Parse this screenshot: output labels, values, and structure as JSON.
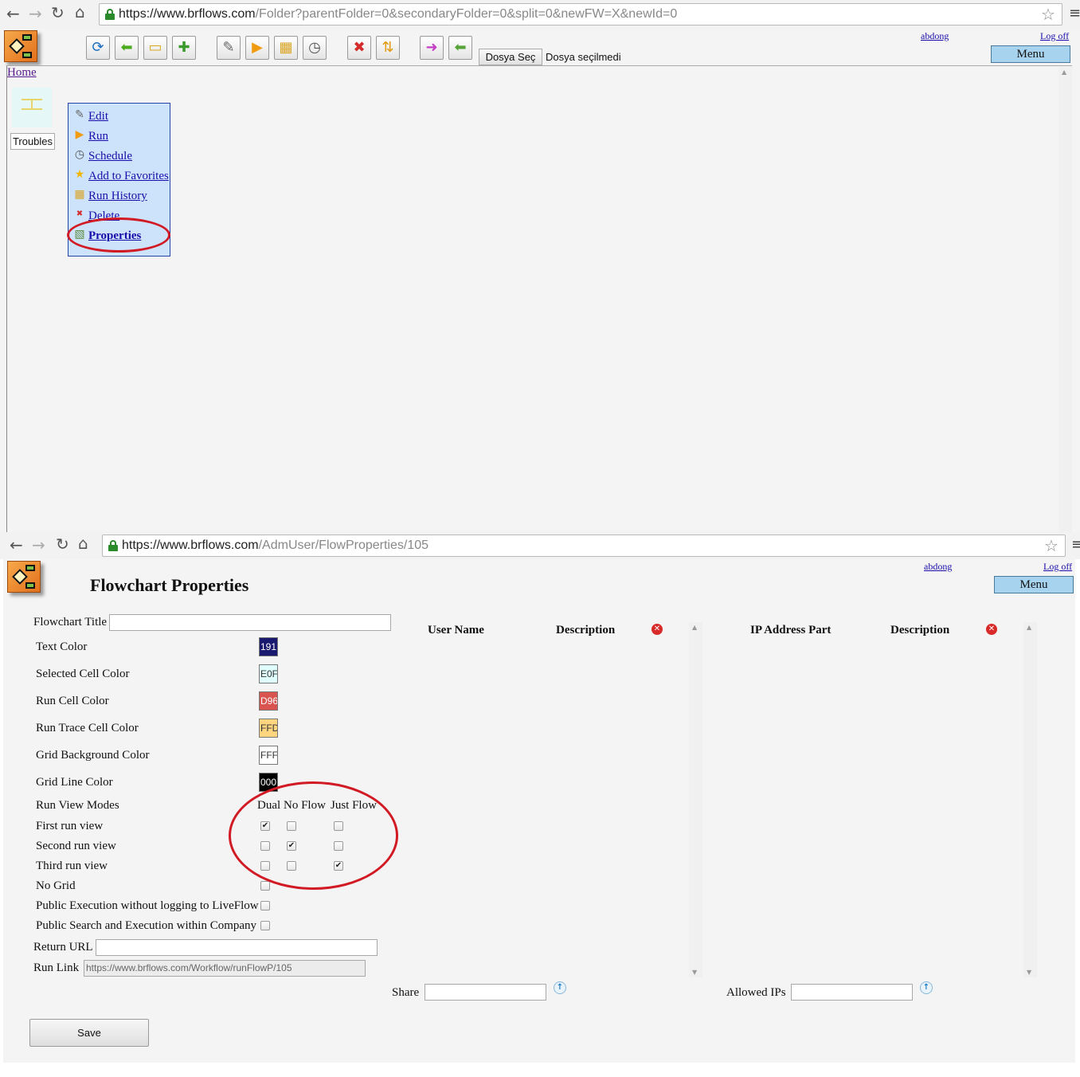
{
  "window1": {
    "url_host": "https://www.brflows.com",
    "url_path": "/Folder?parentFolder=0&secondaryFolder=0&split=0&newFW=X&newId=0",
    "user_link": "abdong",
    "logoff_link": "Log off",
    "menu_button": "Menu",
    "file_button": "Dosya Seç",
    "file_status": "Dosya seçilmedi",
    "breadcrumb_home": "Home",
    "folder_item_label": "Troubles",
    "context_menu": {
      "edit": "Edit",
      "run": "Run",
      "schedule": "Schedule",
      "favorites": "Add to Favorites",
      "history": "Run History",
      "delete": "Delete",
      "properties": "Properties"
    }
  },
  "window2": {
    "url_host": "https://www.brflows.com",
    "url_path": "/AdmUser/FlowProperties/105",
    "user_link": "abdong",
    "logoff_link": "Log off",
    "menu_button": "Menu",
    "page_title": "Flowchart Properties",
    "form": {
      "flowchart_title_label": "Flowchart Title",
      "flowchart_title_value": "",
      "text_color_label": "Text Color",
      "text_color_value": "191",
      "selected_cell_label": "Selected Cell Color",
      "selected_cell_value": "E0F",
      "run_cell_label": "Run Cell Color",
      "run_cell_value": "D96",
      "run_trace_label": "Run Trace Cell Color",
      "run_trace_value": "FFD",
      "grid_bg_label": "Grid Background Color",
      "grid_bg_value": "FFF",
      "grid_line_label": "Grid Line Color",
      "grid_line_value": "000",
      "run_view_modes_label": "Run View Modes",
      "mode_dual": "Dual",
      "mode_noflow": "No Flow",
      "mode_justflow": "Just Flow",
      "first_run_label": "First run view",
      "second_run_label": "Second run view",
      "third_run_label": "Third run view",
      "no_grid_label": "No Grid",
      "public_exec_label": "Public Execution without logging to LiveFlow",
      "public_search_label": "Public Search and Execution within Company",
      "return_url_label": "Return URL",
      "return_url_value": "",
      "run_link_label": "Run Link",
      "run_link_value": "https://www.brflows.com/Workflow/runFlowP/105",
      "save_button": "Save"
    },
    "users_table": {
      "col_user": "User Name",
      "col_desc": "Description",
      "share_label": "Share",
      "share_value": ""
    },
    "ip_table": {
      "col_ip": "IP Address Part",
      "col_desc": "Description",
      "allowed_label": "Allowed IPs",
      "allowed_value": ""
    },
    "colors": {
      "text": "#191970",
      "selected_cell": "#E0FFFF",
      "run_cell": "#D9534F",
      "run_trace": "#FFD580",
      "grid_bg": "#FFFFFF",
      "grid_line": "#000000"
    },
    "run_views": {
      "first": [
        true,
        false,
        false
      ],
      "second": [
        false,
        true,
        false
      ],
      "third": [
        false,
        false,
        true
      ]
    },
    "no_grid": false,
    "public_exec": false,
    "public_search": false
  }
}
